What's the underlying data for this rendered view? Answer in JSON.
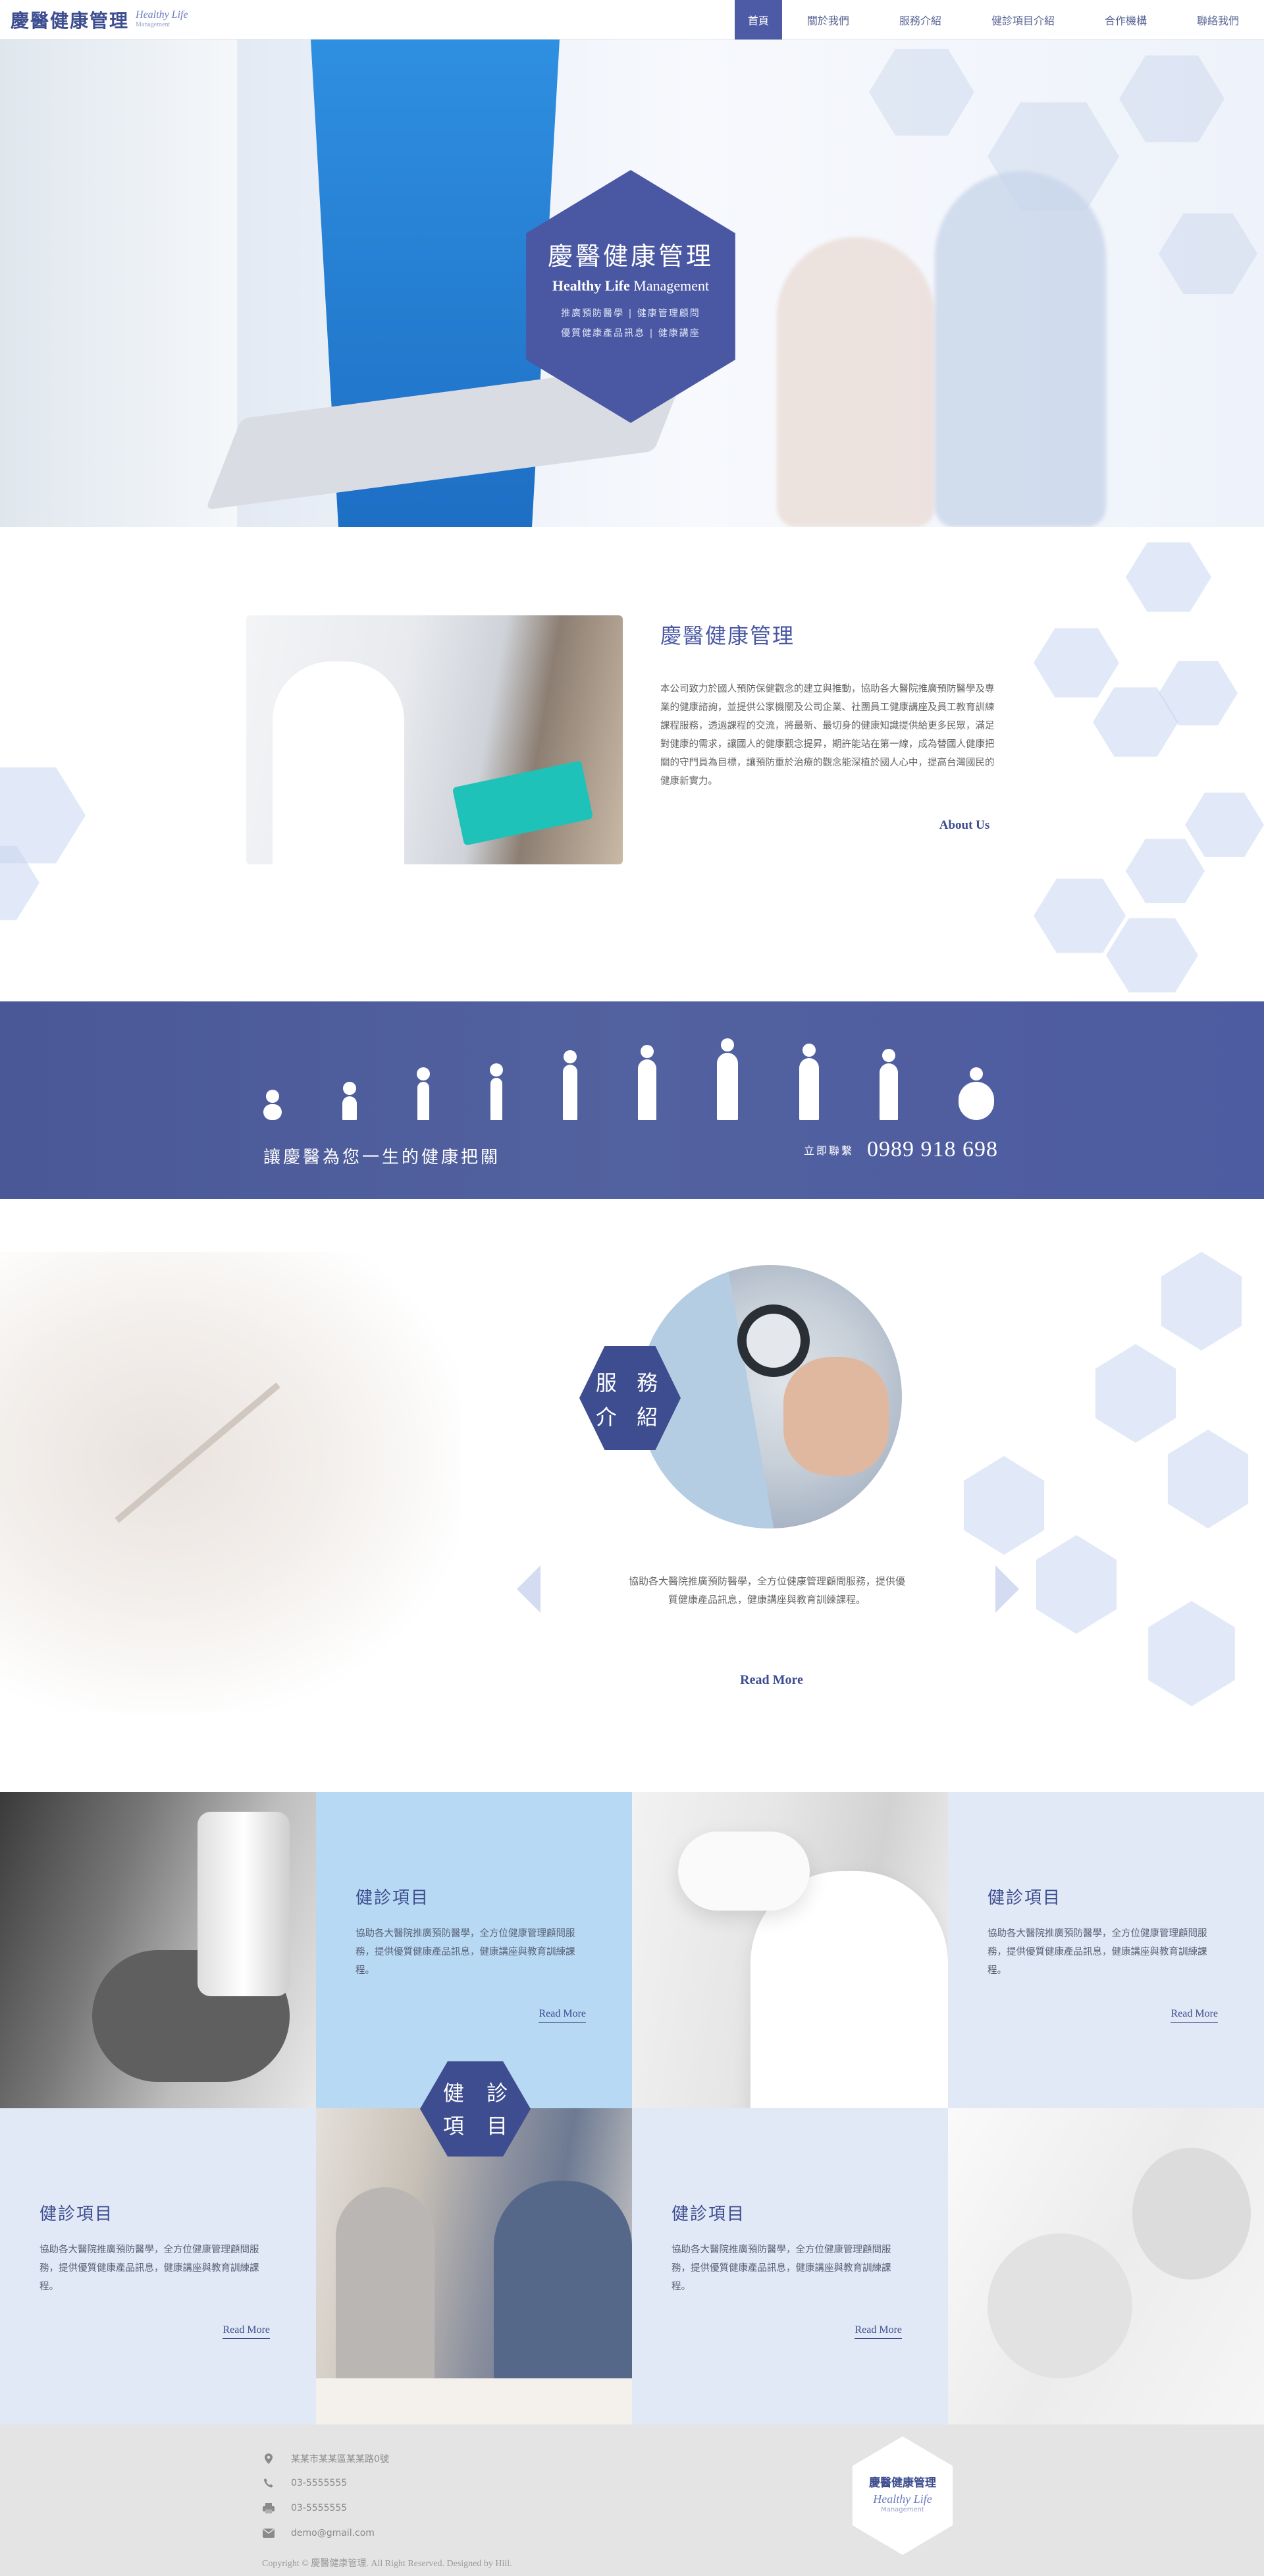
{
  "header": {
    "logo_zh": "慶醫健康管理",
    "logo_en": "Healthy Life",
    "logo_en_small": "Management",
    "nav": [
      "首頁",
      "關於我們",
      "服務介紹",
      "健診項目介紹",
      "合作機構",
      "聯絡我們"
    ]
  },
  "hero": {
    "title": "慶醫健康管理",
    "subtitle_bold": "Healthy Life",
    "subtitle_rest": " Management",
    "line1": "推廣預防醫學 | 健康管理顧問",
    "line2": "優質健康產品訊息 | 健康講座"
  },
  "about": {
    "title": "慶醫健康管理",
    "text": "本公司致力於國人預防保健觀念的建立與推動，協助各大醫院推廣預防醫學及專業的健康諮詢，並提供公家機關及公司企業、社團員工健康講座及員工教育訓練課程服務，透過課程的交流，將最新、最切身的健康知識提供給更多民眾，滿足對健康的需求，讓國人的健康觀念提昇，期許能站在第一線，成為替國人健康把關的守門員為目標，讓預防重於治療的觀念能深植於國人心中，提高台灣國民的健康新實力。",
    "button": "About Us"
  },
  "banner": {
    "slogan": "讓慶醫為您一生的健康把關",
    "contact_label": "立即聯繫",
    "phone": "0989 918 698"
  },
  "services": {
    "badge_l1": "服 務",
    "badge_l2": "介 紹",
    "text": "協助各大醫院推廣預防醫學，全方位健康管理顧問服務，提供優質健康產品訊息，健康講座與教育訓練課程。",
    "button": "Read More"
  },
  "grid": {
    "badge_l1": "健 診",
    "badge_l2": "項 目",
    "items": [
      {
        "title": "健診項目",
        "desc": "協助各大醫院推廣預防醫學，全方位健康管理顧問服務，提供優質健康產品訊息，健康講座與教育訓練課程。",
        "more": "Read More"
      },
      {
        "title": "健診項目",
        "desc": "協助各大醫院推廣預防醫學，全方位健康管理顧問服務，提供優質健康產品訊息，健康講座與教育訓練課程。",
        "more": "Read More"
      },
      {
        "title": "健診項目",
        "desc": "協助各大醫院推廣預防醫學，全方位健康管理顧問服務，提供優質健康產品訊息，健康講座與教育訓練課程。",
        "more": "Read More"
      },
      {
        "title": "健診項目",
        "desc": "協助各大醫院推廣預防醫學，全方位健康管理顧問服務，提供優質健康產品訊息，健康講座與教育訓練課程。",
        "more": "Read More"
      }
    ]
  },
  "footer": {
    "address": "某某市某某區某某路0號",
    "phone": "03-5555555",
    "fax": "03-5555555",
    "email": "demo@gmail.com",
    "copyright": "Copyright © 慶醫健康管理. All Right Reserved. Designed by Hiil.",
    "logo_zh": "慶醫健康管理",
    "logo_en": "Healthy Life",
    "logo_en_small": "Management"
  },
  "colors": {
    "brand": "#3d4d8f",
    "brand_light": "#4a58a3",
    "banner": "#4d5ba0",
    "cell_blue": "#b8d9f4",
    "cell_pale": "#e1e9f6",
    "footer": "#e4e4e4"
  },
  "icons": [
    "map-pin-icon",
    "phone-icon",
    "fax-icon",
    "email-icon",
    "prev-arrow-icon",
    "next-arrow-icon"
  ]
}
